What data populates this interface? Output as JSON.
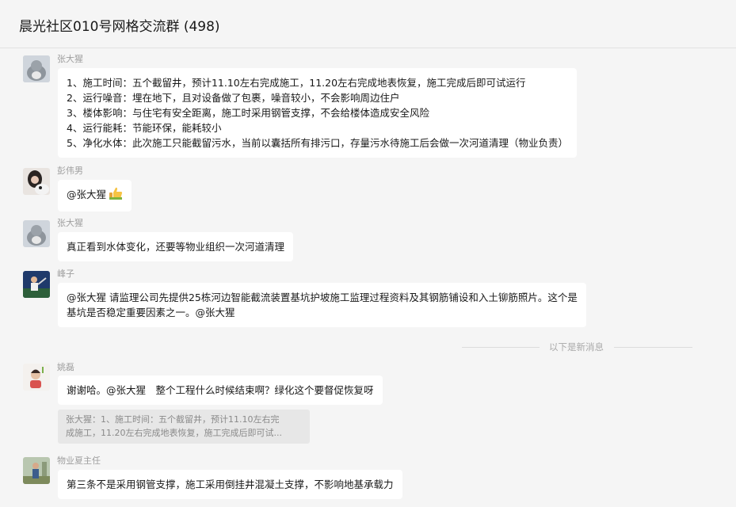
{
  "chat": {
    "title": "晨光社区010号网格交流群 (498)"
  },
  "messages": [
    {
      "sender": "张大猩",
      "lines": [
        "1、施工时间：五个截留井，预计11.10左右完成施工，11.20左右完成地表恢复，施工完成后即可试运行",
        "2、运行噪音：埋在地下，且对设备做了包裹，噪音较小，不会影响周边住户",
        "3、楼体影响：与住宅有安全距离，施工时采用钢管支撑，不会给楼体造成安全风险",
        "4、运行能耗：节能环保，能耗较小",
        "5、净化水体：此次施工只能截留污水，当前以囊括所有排污口，存量污水待施工后会做一次河道清理（物业负责）"
      ]
    },
    {
      "sender": "彭伟男",
      "text": "@张大猩",
      "emoji": "thumbs-up-icon"
    },
    {
      "sender": "张大猩",
      "text": "真正看到水体变化，还要等物业组织一次河道清理"
    },
    {
      "sender": "峰子",
      "lines": [
        "@张大猩 请监理公司先提供25栋河边智能截流装置基坑护坡施工监理过程资料及其钢筋铺设和入土铆筋照片。这个是",
        "基坑是否稳定重要因素之一。@张大猩"
      ]
    },
    {
      "sender": "姚磊",
      "text": "谢谢哈。@张大猩　整个工程什么时候结束啊？绿化这个要督促恢复呀",
      "quote_lines": [
        "张大猩：1、施工时间：五个截留井，预计11.10左右完",
        "成施工，11.20左右完成地表恢复，施工完成后即可试..."
      ]
    },
    {
      "sender": "物业夏主任",
      "text": "第三条不是采用钢管支撑，施工采用倒挂井混凝土支撑，不影响地基承载力"
    }
  ],
  "divider": {
    "label": "以下是新消息"
  },
  "colors": {
    "background": "#f5f5f5",
    "bubble": "#ffffff",
    "sender_name": "#9e9e9e",
    "quote_bg": "#e7e7e7"
  }
}
